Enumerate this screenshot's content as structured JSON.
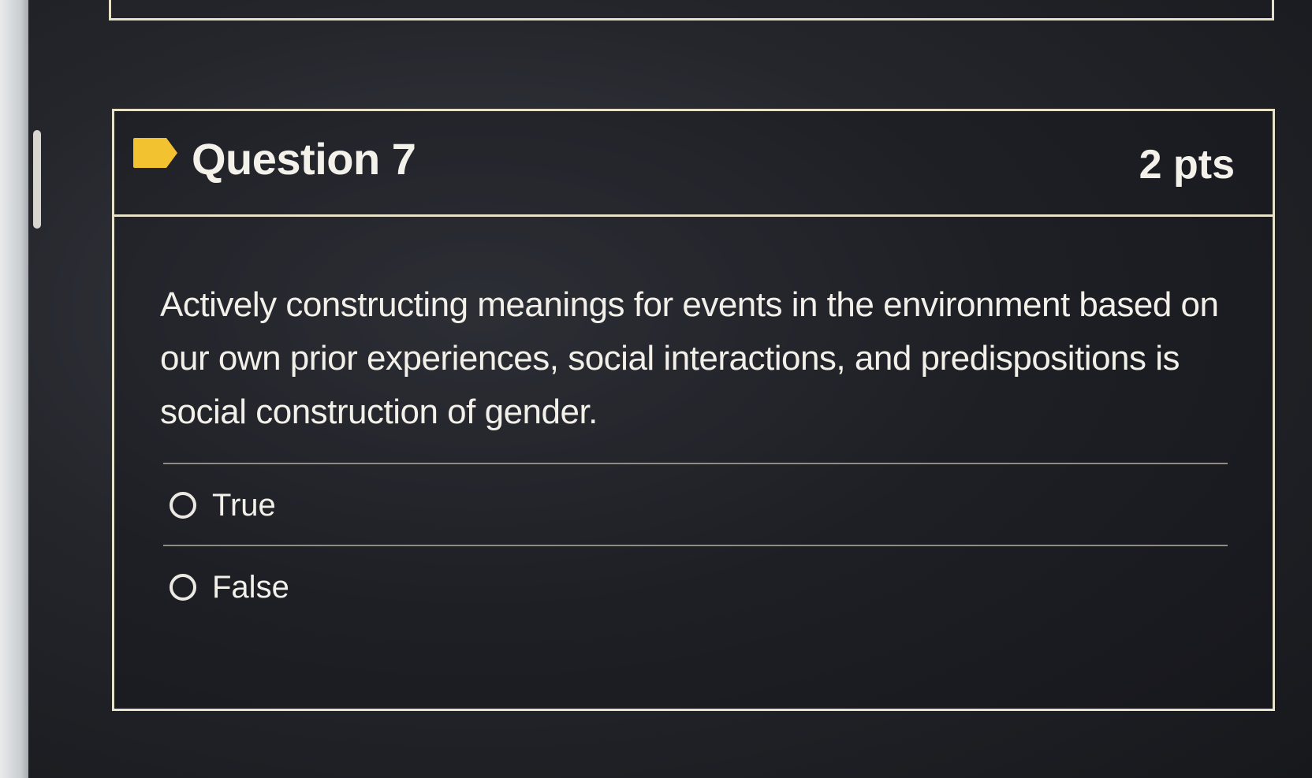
{
  "question": {
    "title": "Question 7",
    "points": "2 pts",
    "flag_color": "#F2C230",
    "text": "Actively constructing meanings for events in the environment based on our own prior experiences, social interactions, and predispositions is social construction of gender.",
    "options": [
      {
        "label": "True",
        "selected": false
      },
      {
        "label": "False",
        "selected": false
      }
    ]
  },
  "icons": {
    "flag": "flag-icon",
    "radio": "radio-icon"
  }
}
